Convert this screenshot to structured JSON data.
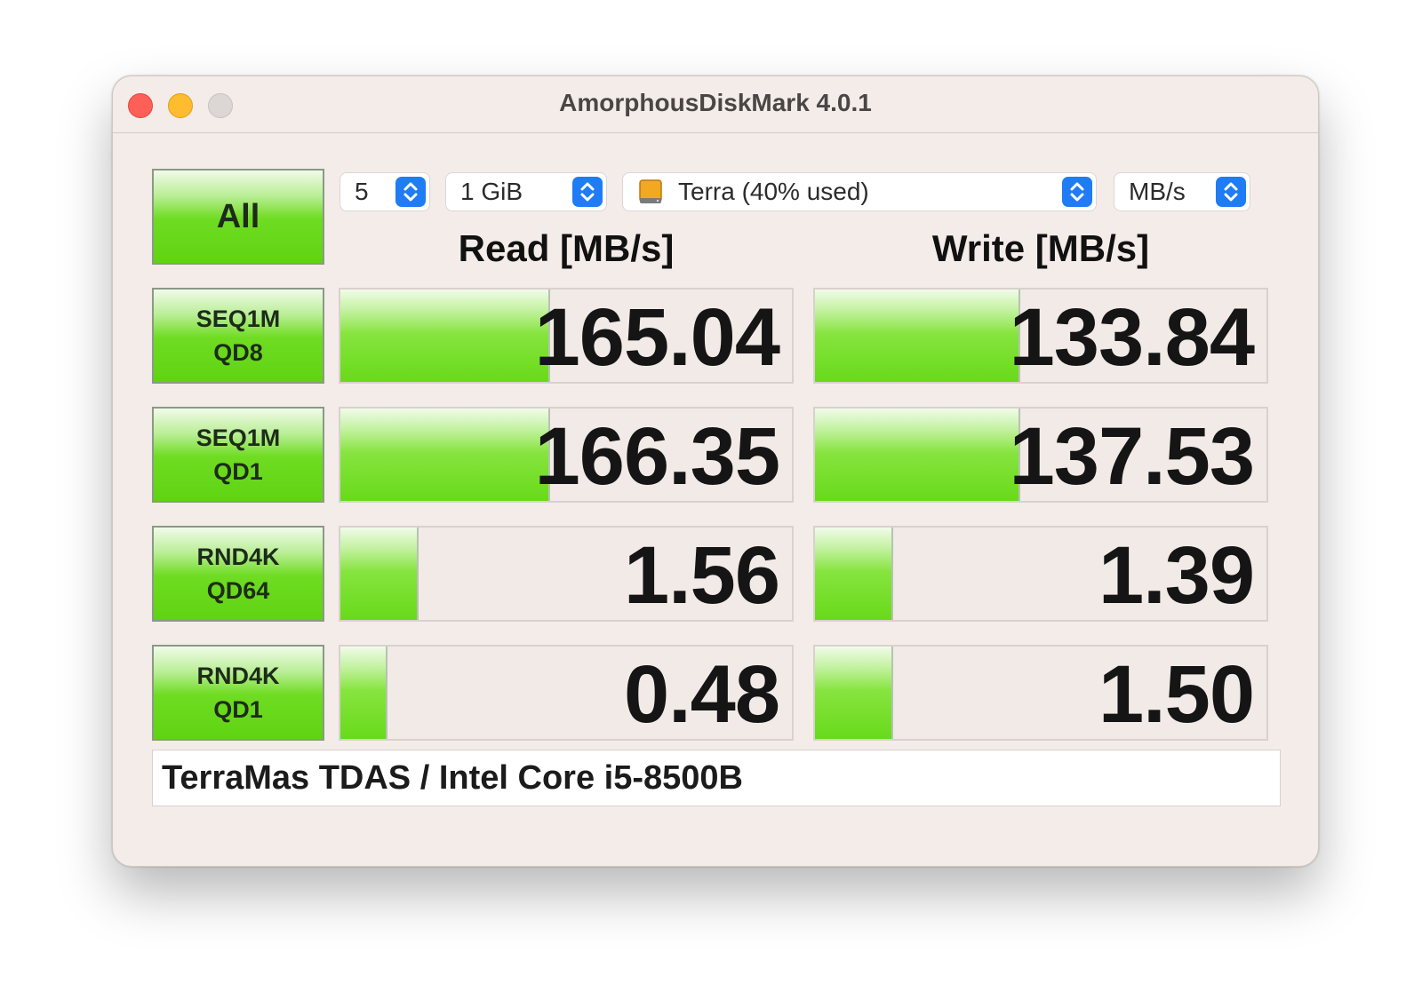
{
  "window": {
    "title": "AmorphousDiskMark 4.0.1"
  },
  "toolbar": {
    "all_label": "All",
    "count": "5",
    "size": "1 GiB",
    "target": "Terra (40% used)",
    "unit": "MB/s"
  },
  "columns": {
    "read": "Read [MB/s]",
    "write": "Write [MB/s]"
  },
  "tests": [
    {
      "line1": "SEQ1M",
      "line2": "QD8",
      "read": "165.04",
      "write": "133.84",
      "read_fill": 0.46,
      "write_fill": 0.45
    },
    {
      "line1": "SEQ1M",
      "line2": "QD1",
      "read": "166.35",
      "write": "137.53",
      "read_fill": 0.46,
      "write_fill": 0.45
    },
    {
      "line1": "RND4K",
      "line2": "QD64",
      "read": "1.56",
      "write": "1.39",
      "read_fill": 0.17,
      "write_fill": 0.17
    },
    {
      "line1": "RND4K",
      "line2": "QD1",
      "read": "0.48",
      "write": "1.50",
      "read_fill": 0.1,
      "write_fill": 0.17
    }
  ],
  "info": {
    "text": "TerraMas TDAS / Intel Core i5-8500B"
  },
  "colors": {
    "accent": "#1f7cf5",
    "bar_green": "#68da1a",
    "close": "#fe5f57",
    "minimize": "#febc2e"
  },
  "icons": {
    "close": "close-icon",
    "minimize": "minimize-icon",
    "zoom": "zoom-icon",
    "disk": "disk-icon",
    "stepper": "chevron-updown-icon"
  }
}
